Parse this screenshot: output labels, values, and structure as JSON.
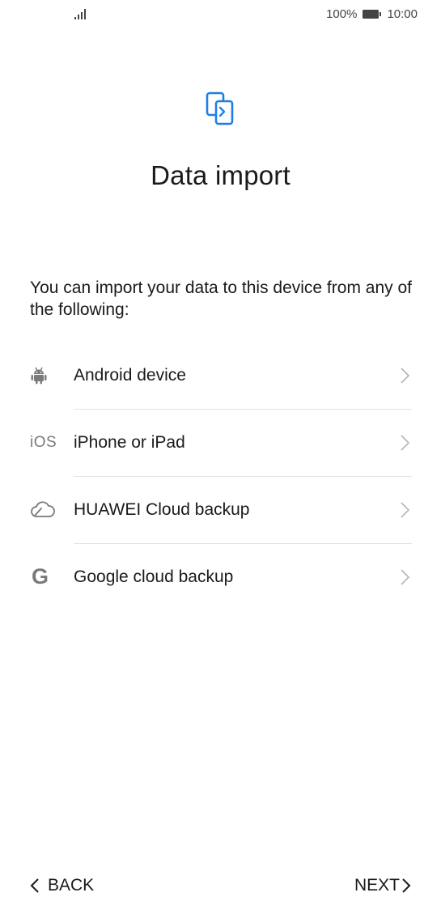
{
  "status_bar": {
    "battery_percent": "100%",
    "time": "10:00",
    "signal_icon": "signal-bars-icon",
    "battery_icon": "battery-full-icon"
  },
  "header": {
    "icon": "phone-transfer-icon",
    "title": "Data import"
  },
  "intro_text": "You can import your data to this device from any of the following:",
  "sources": [
    {
      "icon": "android-icon",
      "label": "Android device"
    },
    {
      "icon": "ios-icon",
      "icon_text": "iOS",
      "label": "iPhone or iPad"
    },
    {
      "icon": "cloud-icon",
      "label": "HUAWEI Cloud backup"
    },
    {
      "icon": "google-icon",
      "icon_text": "G",
      "label": "Google cloud backup"
    }
  ],
  "footer": {
    "back_label": "BACK",
    "next_label": "NEXT"
  },
  "colors": {
    "accent": "#1f7fe8",
    "text": "#1a1a1a",
    "icon_gray": "#7a7a7a",
    "divider": "#e2e2e2"
  }
}
